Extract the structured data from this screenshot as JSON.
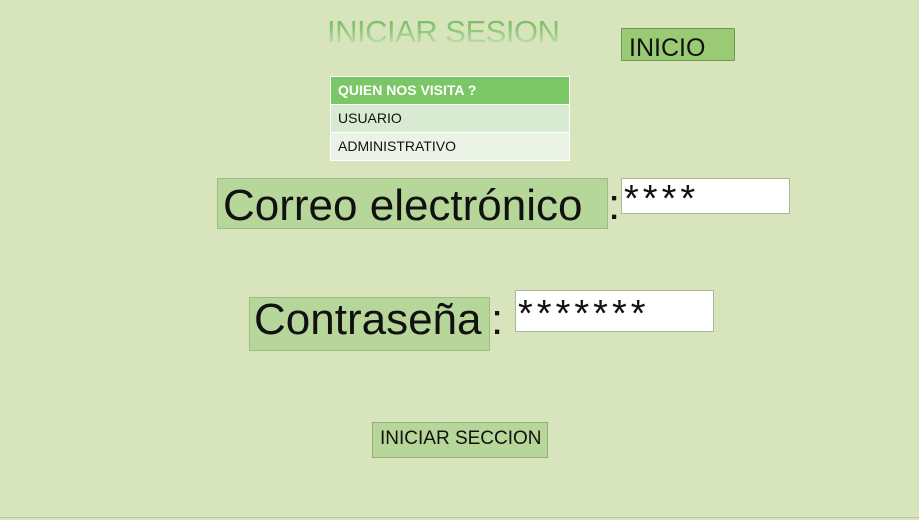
{
  "page": {
    "title": "INICIAR SESION",
    "inicio_button": "INICIO",
    "background_color": "#d8e4bc",
    "accent_color": "#7bc766"
  },
  "visit_table": {
    "header": "QUIEN NOS VISITA ?",
    "options": [
      "USUARIO",
      "ADMINISTRATIVO"
    ]
  },
  "form": {
    "email_label": "Correo electrónico",
    "email_colon": ":",
    "email_value": "****",
    "password_label": "Contraseña",
    "password_colon": ":",
    "password_value": "*******",
    "submit_label": "INICIAR SECCION"
  }
}
